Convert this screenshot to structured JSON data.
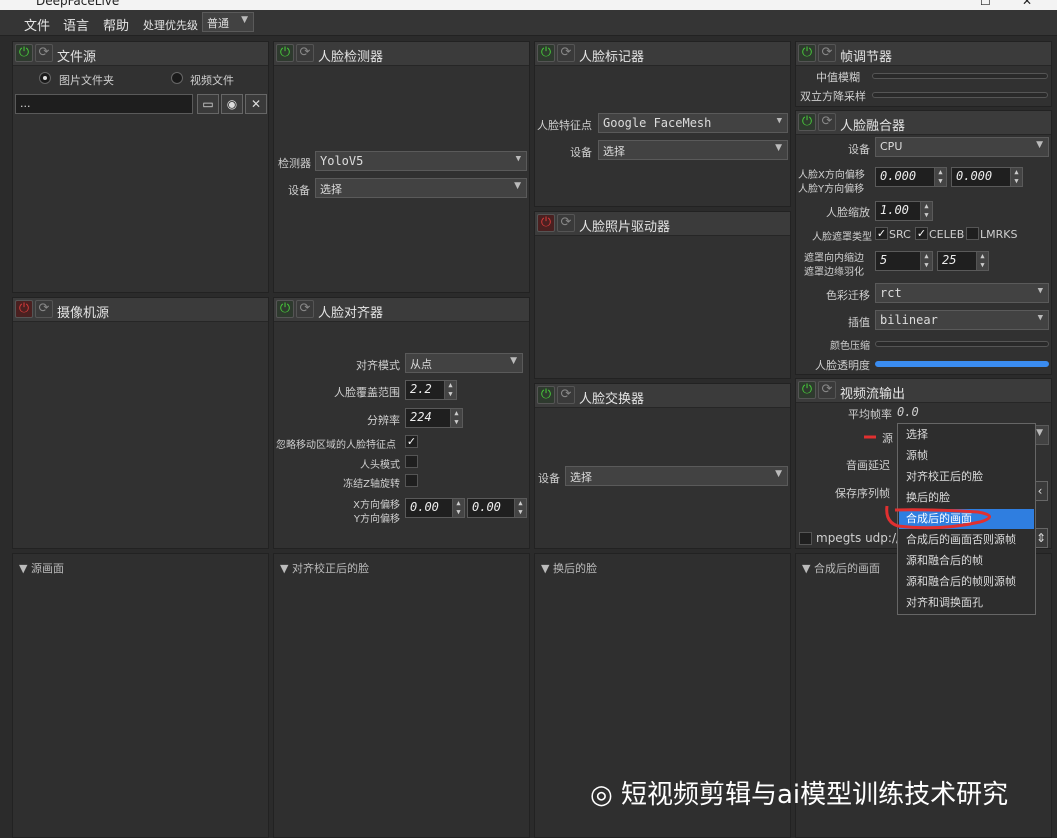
{
  "window": {
    "title": "DeepFaceLive"
  },
  "menu": {
    "file": "文件",
    "language": "语言",
    "help": "帮助",
    "priority_label": "处理优先级",
    "priority_value": "普通"
  },
  "file_source": {
    "title": "文件源",
    "radio_folder": "图片文件夹",
    "radio_video": "视频文件",
    "path_value": "..."
  },
  "face_detector": {
    "title": "人脸检测器",
    "detector_label": "检测器",
    "detector_value": "YoloV5",
    "device_label": "设备",
    "device_value": "选择"
  },
  "face_marker": {
    "title": "人脸标记器",
    "landmarks_label": "人脸特征点",
    "landmarks_value": "Google FaceMesh",
    "device_label": "设备",
    "device_value": "选择"
  },
  "frame_adjuster": {
    "title": "帧调节器",
    "median_blur": "中值模糊",
    "bicubic": "双立方降采样"
  },
  "face_merger": {
    "title": "人脸融合器",
    "device_label": "设备",
    "device_value": "CPU",
    "x_offset_label": "人脸X方向偏移",
    "y_offset_label": "人脸Y方向偏移",
    "x_offset": "0.000",
    "y_offset": "0.000",
    "scale_label": "人脸缩放",
    "scale": "1.00",
    "mask_type_label": "人脸遮罩类型",
    "mask_src": "SRC",
    "mask_celeb": "CELEB",
    "mask_lmrks": "LMRKS",
    "erode_label": "遮罩向内缩边",
    "blur_label": "遮罩边缘羽化",
    "erode": "5",
    "blur": "25",
    "color_transfer_label": "色彩迁移",
    "color_transfer": "rct",
    "interp_label": "插值",
    "interp": "bilinear",
    "color_compress_label": "颜色压缩",
    "opacity_label": "人脸透明度"
  },
  "face_animator": {
    "title": "人脸照片驱动器"
  },
  "camera_source": {
    "title": "摄像机源"
  },
  "face_aligner": {
    "title": "人脸对齐器",
    "mode_label": "对齐模式",
    "mode_value": "从点",
    "coverage_label": "人脸覆盖范围",
    "coverage": "2.2",
    "resolution_label": "分辨率",
    "resolution": "224",
    "exclude_moving_label": "忽略移动区域的人脸特征点",
    "head_mode_label": "人头模式",
    "freeze_z_label": "冻结Z轴旋转",
    "x_offset_label": "X方向偏移",
    "y_offset_label": "Y方向偏移",
    "x_offset": "0.00",
    "y_offset": "0.00"
  },
  "face_swapper": {
    "title": "人脸交换器",
    "device_label": "设备",
    "device_value": "选择"
  },
  "stream_output": {
    "title": "视频流输出",
    "avg_fps_label": "平均帧率",
    "avg_fps": "0.0",
    "source_label": "源",
    "audio_delay_label": "音画延迟",
    "save_seq_label": "保存序列帧",
    "mpegts": "mpegts udp://",
    "popup_items": [
      "选择",
      "源帧",
      "对齐校正后的脸",
      "换后的脸",
      "合成后的画面",
      "合成后的画面否则源帧",
      "源和融合后的帧",
      "源和融合后的帧则源帧",
      "对齐和调换面孔"
    ]
  },
  "views": {
    "source_frame": "源画面",
    "aligned_face": "对齐校正后的脸",
    "swapped_face": "换后的脸",
    "merged_frame": "合成后的画面"
  },
  "watermark": "短视频剪辑与ai模型训练技术研究"
}
